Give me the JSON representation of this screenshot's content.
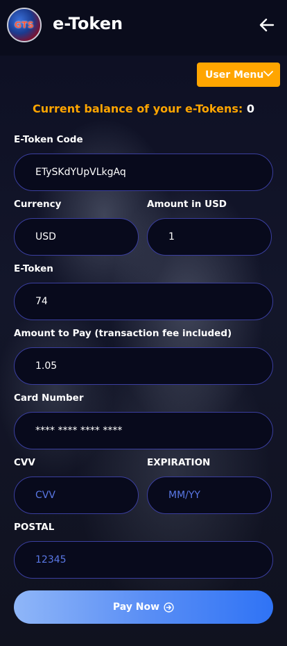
{
  "header": {
    "logo_text": "GTS",
    "title": "e-Token",
    "back_icon": "arrow-left-icon"
  },
  "user_menu": {
    "label": "User Menu",
    "icon": "chevron-down-icon",
    "color": "#ffa500"
  },
  "balance": {
    "label": "Current balance of your e-Tokens:",
    "value": "0"
  },
  "form": {
    "etoken_code": {
      "label": "E-Token Code",
      "value": "ETySKdYUpVLkgAq"
    },
    "currency": {
      "label": "Currency",
      "value": "USD"
    },
    "amount_usd": {
      "label": "Amount in USD",
      "value": "1"
    },
    "etoken": {
      "label": "E-Token",
      "value": "74"
    },
    "amount_to_pay": {
      "label": "Amount to Pay (transaction fee included)",
      "value": "1.05"
    },
    "card_number": {
      "label": "Card Number",
      "value": "**** **** **** ****"
    },
    "cvv": {
      "label": "CVV",
      "placeholder": "CVV"
    },
    "expiration": {
      "label": "EXPIRATION",
      "placeholder": "MM/YY"
    },
    "postal": {
      "label": "POSTAL",
      "placeholder": "12345"
    }
  },
  "pay_button": {
    "label": "Pay Now",
    "icon": "arrow-right-circle-icon"
  }
}
